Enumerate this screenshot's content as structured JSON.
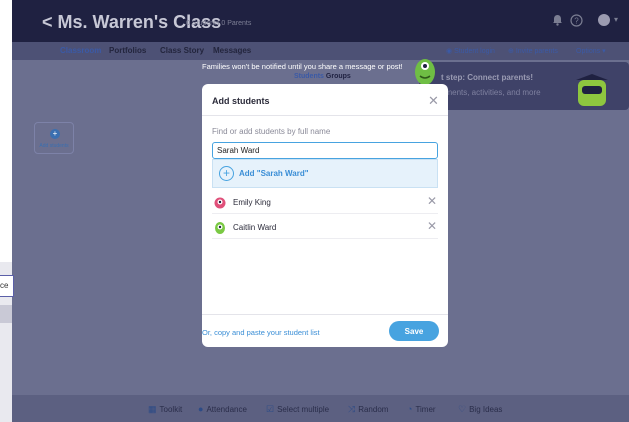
{
  "header": {
    "title": "< Ms. Warren's Class",
    "counts": "0 Students  0 Parents",
    "bell_icon": "bell-icon",
    "help_icon": "help-icon"
  },
  "nav": {
    "tabs": [
      {
        "label": "Classroom",
        "active": true
      },
      {
        "label": "Portfolios",
        "active": false
      },
      {
        "label": "Class Story",
        "active": false
      },
      {
        "label": "Messages",
        "active": false
      }
    ],
    "student_login": "Student login",
    "invite_parents": "Invite parents",
    "options": "Options"
  },
  "notice": "Families won't be notified until you share a message or post!",
  "sub_tabs": {
    "students": "Students",
    "groups": "Groups"
  },
  "side": {
    "add_students": "Add students"
  },
  "outside_text": "ce",
  "banner": {
    "title": "t step: Connect parents!",
    "subtitle": "oments, activities, and more"
  },
  "modal": {
    "title": "Add students",
    "find_label": "Find or add students by full name",
    "search_value": "Sarah Ward",
    "suggestion": "Add \"Sarah Ward\"",
    "students": [
      {
        "name": "Emily King",
        "avatar_color": "#e0507a"
      },
      {
        "name": "Caitlin Ward",
        "avatar_color": "#7ac943"
      }
    ],
    "paste_link": "Or, copy and paste your student list",
    "save_label": "Save"
  },
  "toolbar": {
    "items": [
      "Toolkit",
      "Attendance",
      "Select multiple",
      "Random",
      "Timer",
      "Big Ideas"
    ]
  },
  "colors": {
    "accent": "#47a3e0",
    "header": "#1f2141",
    "overlay": "#6b6f8f"
  }
}
